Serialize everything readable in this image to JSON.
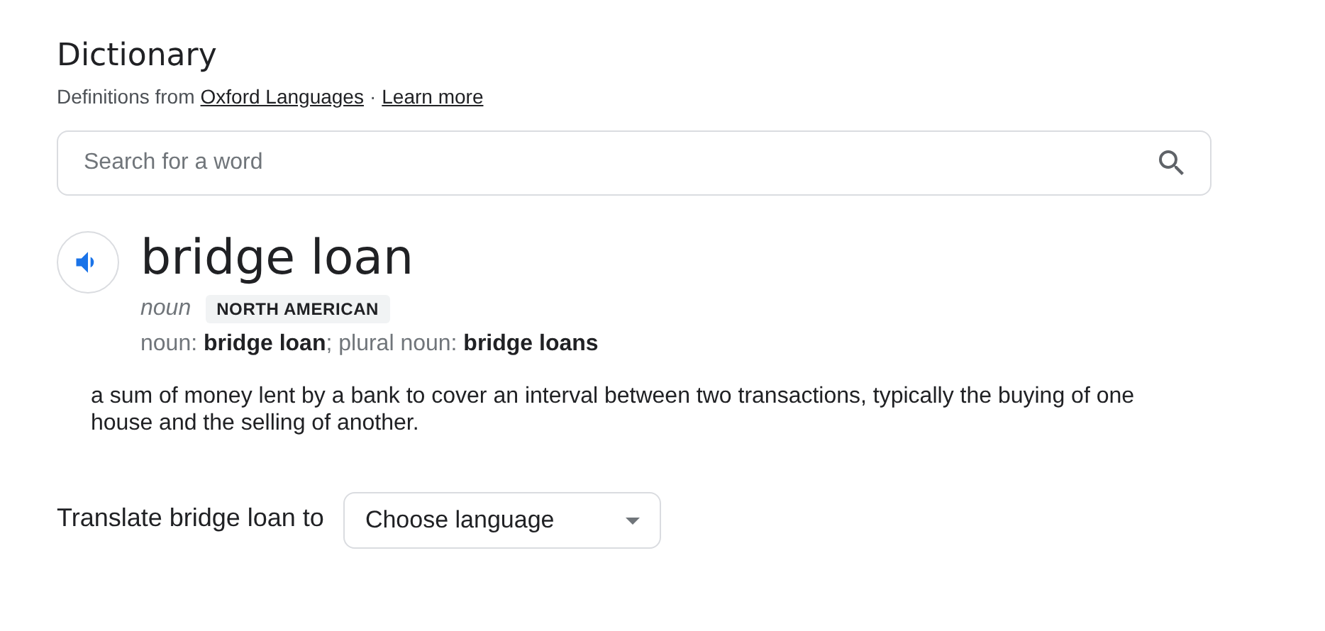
{
  "header": {
    "title": "Dictionary",
    "source_prefix": "Definitions from",
    "source_link": "Oxford Languages",
    "separator": "·",
    "learn_more": "Learn more"
  },
  "search": {
    "placeholder": "Search for a word"
  },
  "entry": {
    "word": "bridge loan",
    "part_of_speech": "noun",
    "label": "NORTH AMERICAN",
    "forms": "noun: **bridge loan**; plural noun: **bridge loans**",
    "definitions": [
      "a sum of money lent by a bank to cover an interval between two transactions, typically the buying of one house and the selling of another."
    ]
  },
  "translate": {
    "label": "Translate bridge loan to",
    "dropdown": "Choose language"
  }
}
